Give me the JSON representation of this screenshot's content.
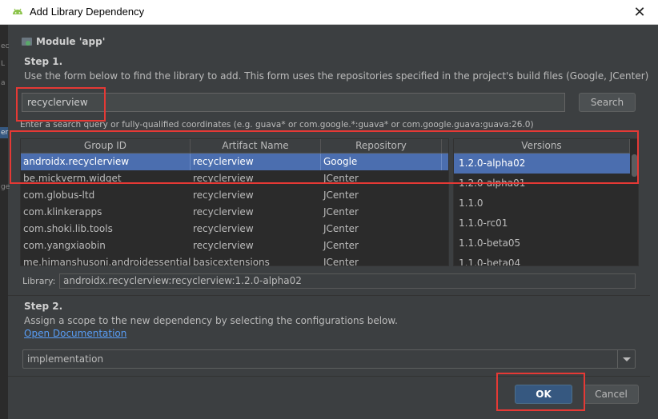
{
  "window": {
    "title": "Add Library Dependency",
    "close_glyph": "✕"
  },
  "left_strip": {
    "fragments": [
      "ec",
      "L",
      "a",
      "er",
      "ge"
    ]
  },
  "module": {
    "label": "Module 'app'",
    "icon": "module-folder-icon"
  },
  "step1": {
    "title": "Step 1.",
    "description": "Use the form below to find the library to add. This form uses the repositories specified in the project's build files (Google, JCenter)"
  },
  "search": {
    "value": "recyclerview",
    "button_label": "Search",
    "hint": "Enter a search query or fully-qualified coordinates (e.g. guava* or com.google.*:guava* or com.google.guava:guava:26.0)"
  },
  "results": {
    "columns": [
      "Group ID",
      "Artifact Name",
      "Repository"
    ],
    "rows": [
      {
        "group": "androidx.recyclerview",
        "artifact": "recyclerview",
        "repo": "Google"
      },
      {
        "group": "be.mickverm.widget",
        "artifact": "recyclerview",
        "repo": "JCenter"
      },
      {
        "group": "com.globus-ltd",
        "artifact": "recyclerview",
        "repo": "JCenter"
      },
      {
        "group": "com.klinkerapps",
        "artifact": "recyclerview",
        "repo": "JCenter"
      },
      {
        "group": "com.shoki.lib.tools",
        "artifact": "recyclerview",
        "repo": "JCenter"
      },
      {
        "group": "com.yangxiaobin",
        "artifact": "recyclerview",
        "repo": "JCenter"
      },
      {
        "group": "me.himanshusoni.androidessentials",
        "artifact": "basicextensions",
        "repo": "JCenter"
      }
    ]
  },
  "versions": {
    "header": "Versions",
    "items": [
      "1.2.0-alpha02",
      "1.2.0-alpha01",
      "1.1.0",
      "1.1.0-rc01",
      "1.1.0-beta05",
      "1.1.0-beta04"
    ]
  },
  "library": {
    "label": "Library:",
    "value": "androidx.recyclerview:recyclerview:1.2.0-alpha02"
  },
  "step2": {
    "title": "Step 2.",
    "description": "Assign a scope to the new dependency by selecting the configurations below.",
    "link": "Open Documentation"
  },
  "scope": {
    "value": "implementation"
  },
  "buttons": {
    "ok": "OK",
    "cancel": "Cancel"
  },
  "colors": {
    "accent": "#4b6eaf",
    "highlight": "#e53935",
    "background": "#3c3f41",
    "link": "#589df6"
  }
}
